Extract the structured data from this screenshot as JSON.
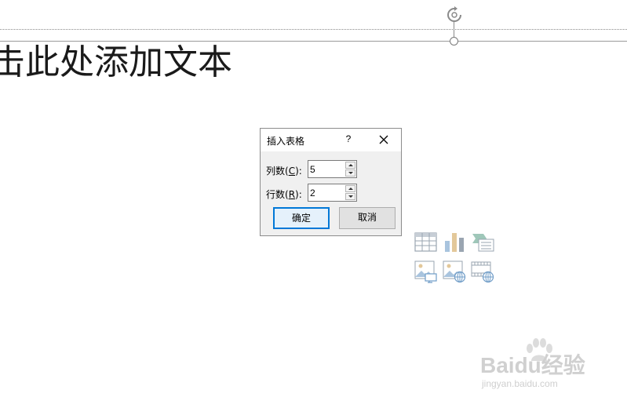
{
  "slide": {
    "placeholder_text": "击此处添加文本"
  },
  "dialog": {
    "title": "插入表格",
    "help_label": "?",
    "columns": {
      "label_prefix": "列数(",
      "mnemonic": "C",
      "label_suffix": "):",
      "value": "5"
    },
    "rows": {
      "label_prefix": "行数(",
      "mnemonic": "R",
      "label_suffix": "):",
      "value": "2"
    },
    "ok_label": "确定",
    "cancel_label": "取消"
  },
  "insert_icons": [
    "table-icon",
    "chart-icon",
    "smartart-icon",
    "picture-icon",
    "online-picture-icon",
    "video-icon"
  ],
  "watermark": {
    "brand": "Baidu经验",
    "url": "jingyan.baidu.com"
  },
  "colors": {
    "accent": "#0078d7",
    "icon_gray": "#9aa5b1",
    "icon_blue": "#a9c4de",
    "icon_tan": "#e3c89a"
  }
}
